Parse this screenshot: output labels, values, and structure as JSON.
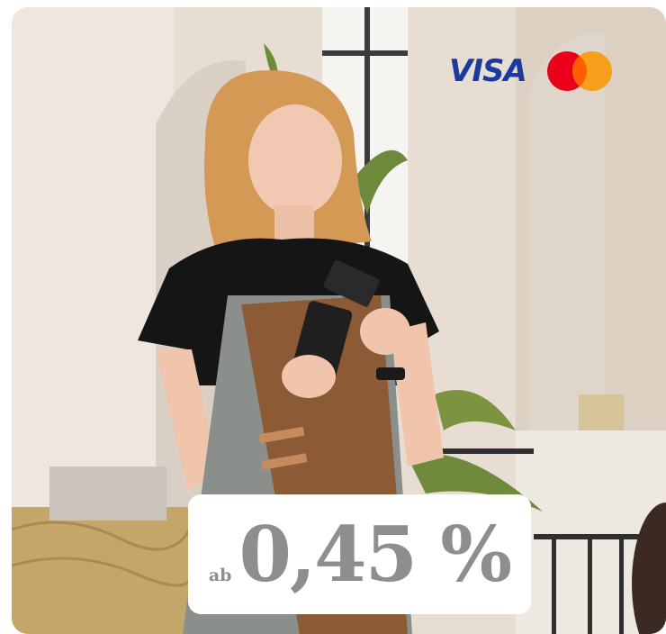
{
  "brands": {
    "visa": "VISA",
    "mastercard_icon": "mastercard-logo",
    "colors": {
      "visa": "#1a3aa0",
      "mc_red": "#eb001b",
      "mc_orange": "#f79e1b",
      "mc_overlap": "#ff5f00"
    }
  },
  "offer": {
    "prefix": "ab",
    "rate": "0,45 %"
  },
  "photo": {
    "description_icon": "merchant-with-card-reader-photo"
  }
}
